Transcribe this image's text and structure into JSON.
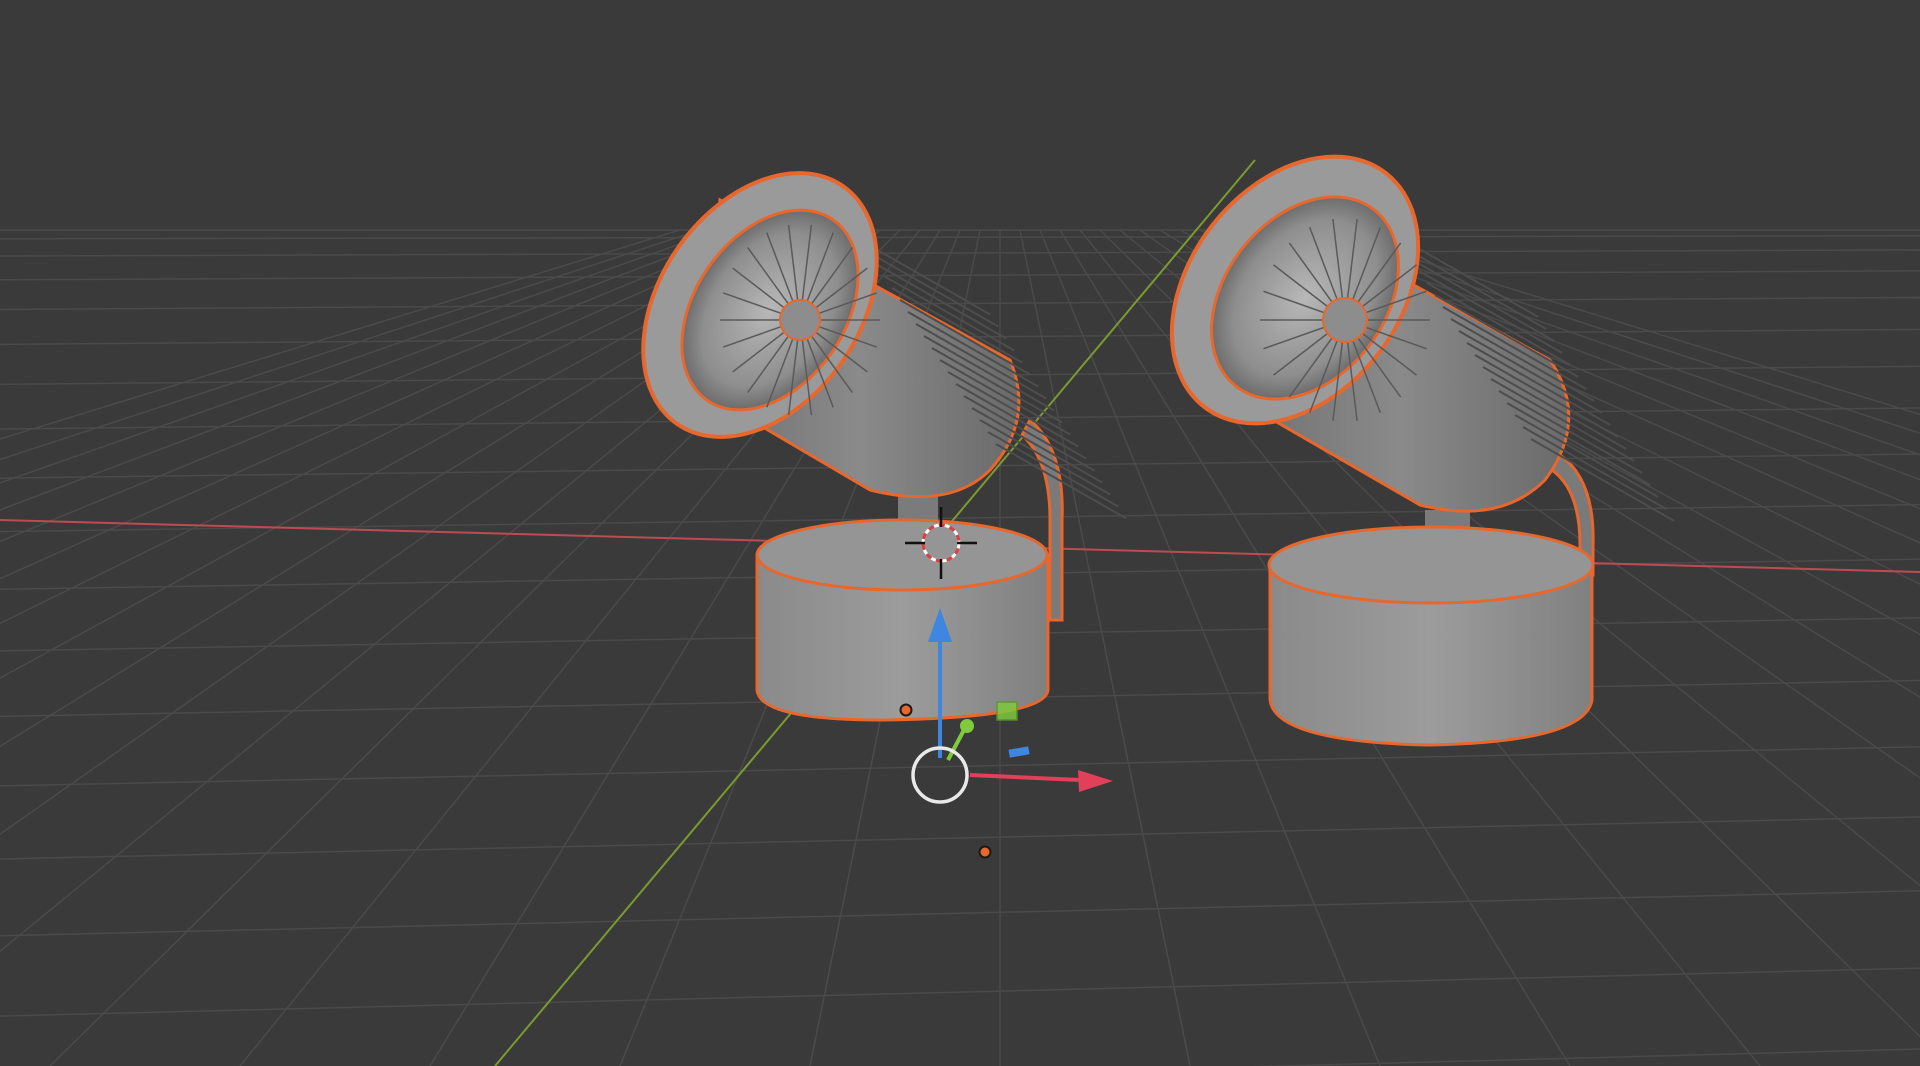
{
  "app": {
    "name": "3D Viewport",
    "view": "perspective"
  },
  "colors": {
    "background": "#3a3a3a",
    "grid_line": "#4a4a4a",
    "axis_x": "#c04a52",
    "axis_y": "#7c9a2e",
    "selection_outline": "#e8672c",
    "mesh_light": "#9e9e9e",
    "mesh_mid": "#7f7f7f",
    "mesh_dark": "#5a5a5a",
    "mesh_shadow": "#3f3f3f",
    "gizmo_z": "#3f86e0",
    "gizmo_y": "#7fc93c",
    "gizmo_x": "#e0405a",
    "gizmo_origin": "#e9e9e9",
    "cursor_red": "#d94040"
  },
  "scene": {
    "objects": [
      {
        "name": "spotlight-left",
        "selected": true
      },
      {
        "name": "spotlight-right",
        "selected": true
      }
    ]
  },
  "gizmo": {
    "type": "translate",
    "axes": [
      "x",
      "y",
      "z"
    ],
    "icons": [
      "move-gizmo-icon",
      "3d-cursor-icon",
      "origin-point-icon"
    ]
  }
}
